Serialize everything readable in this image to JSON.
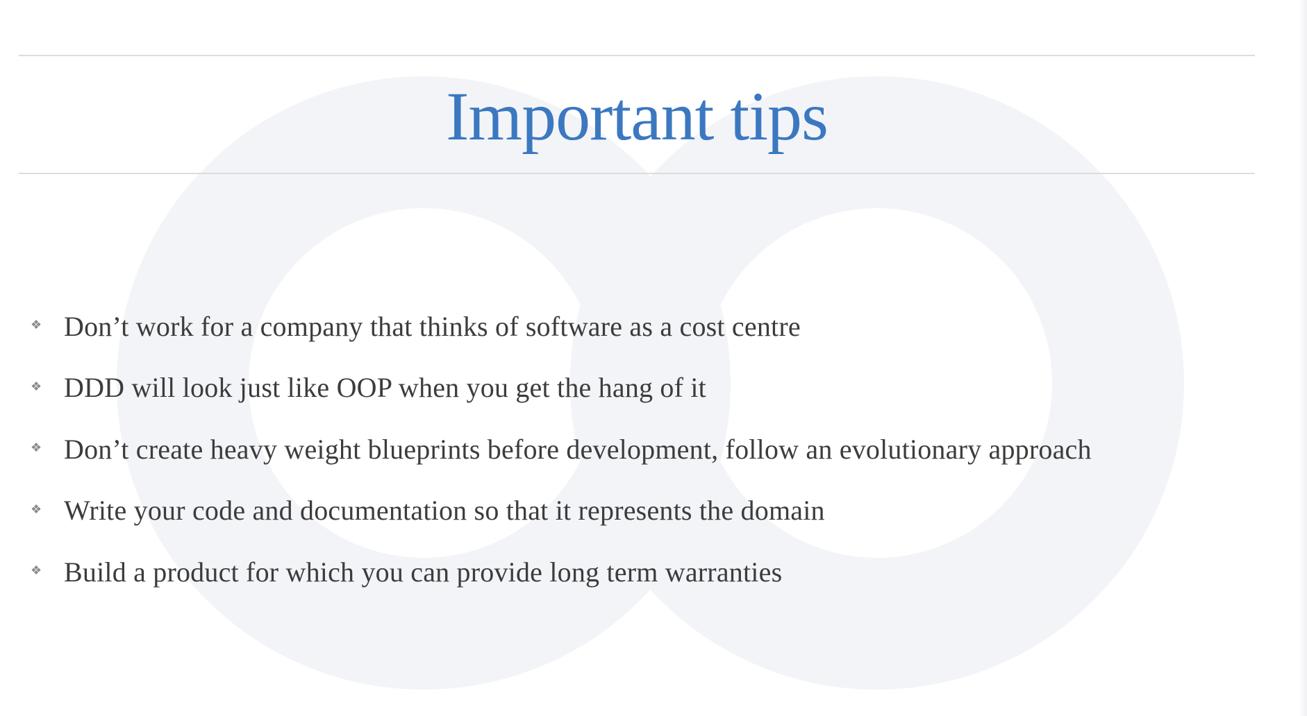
{
  "slide": {
    "title": "Important tips",
    "bullet_icon": "diamond-bullet",
    "tips": [
      {
        "text": "Don’t work for a company that thinks of software as a cost centre"
      },
      {
        "text": "DDD will look just like OOP when you get the hang of it"
      },
      {
        "text": "Don’t create heavy weight blueprints before development, follow an evolutionary approach"
      },
      {
        "text": "Write your code and documentation so that it represents the domain"
      },
      {
        "text": "Build a product for which you can provide long term warranties"
      }
    ]
  },
  "colors": {
    "title": "#3b78c0",
    "body_text": "#3c3c3c",
    "rule": "#dcdcde",
    "watermark": "#f3f4f8"
  }
}
